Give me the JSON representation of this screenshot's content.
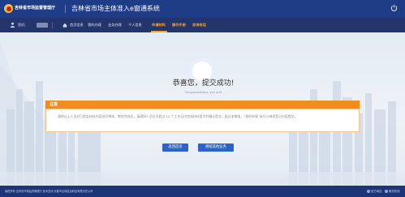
{
  "header": {
    "org_name": "吉林省市场监督管理厅",
    "app_title": "吉林省市场主体准入e窗通系统",
    "icons": [
      "emblem-icon",
      "power-icon"
    ]
  },
  "navbar": {
    "greeting": "您好,",
    "nav_items": [
      {
        "label": "首页信息",
        "active": false
      },
      {
        "label": "我的办理",
        "active": false
      },
      {
        "label": "业务办理",
        "active": false
      },
      {
        "label": "个人信息",
        "active": false
      },
      {
        "label": "申请材料",
        "active": true
      },
      {
        "label": "操作手册",
        "active": true
      },
      {
        "label": "咨询电话",
        "active": true
      }
    ],
    "accent_color": "#f0a33a"
  },
  "result": {
    "title": "恭喜您，提交成功!",
    "subtitle": "Congratulations, you are!"
  },
  "notice": {
    "title": "注意",
    "body": "请将以上人员对已提交材料内容进行审核，审核完成后，请通知人员在不超过 10 个工作日内完成材料签字并确认提交，超过本期限，“我的申请”或可以继续登记内容提交。"
  },
  "buttons": {
    "return_home": "返回首页",
    "continue": "继续其他业务"
  },
  "footer": {
    "copyright": "版权所有·吉林省市场监督管理厅 技术支持:长春市吉网信息科技有限责任公司",
    "right_1": "官方网站",
    "right_2": "服务热线"
  },
  "colors": {
    "header_bg": "#1f3d86",
    "navbar_bg": "#23356b",
    "notice_orange": "#f28c1e",
    "button_blue": "#2d63c7",
    "footer_bg": "#1d3478"
  }
}
